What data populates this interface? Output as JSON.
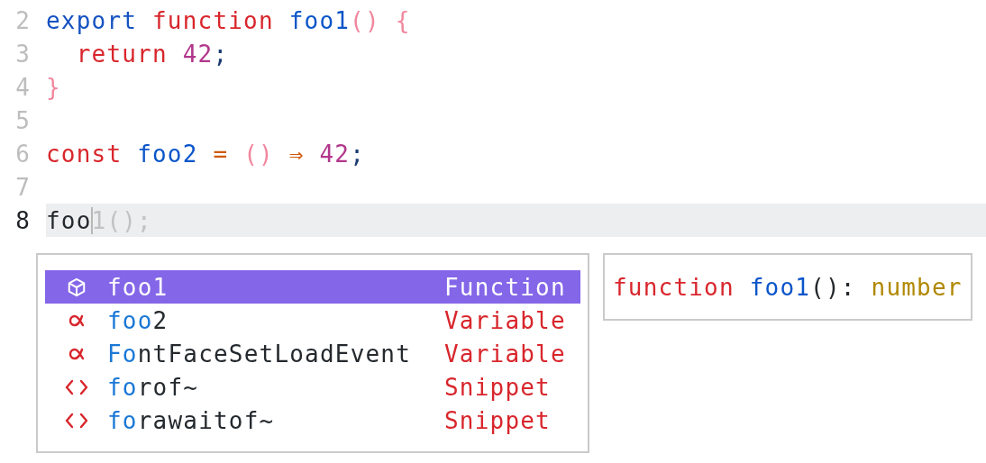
{
  "editor": {
    "lines": [
      {
        "number": "2",
        "active": false,
        "tokens": [
          {
            "text": "export ",
            "kind": "export"
          },
          {
            "text": "function ",
            "kind": "keyword"
          },
          {
            "text": "foo1",
            "kind": "name"
          },
          {
            "text": "() {",
            "kind": "punct"
          }
        ]
      },
      {
        "number": "3",
        "active": false,
        "tokens": [
          {
            "text": "  return ",
            "kind": "keyword"
          },
          {
            "text": "42",
            "kind": "number"
          },
          {
            "text": ";",
            "kind": "semi"
          }
        ]
      },
      {
        "number": "4",
        "active": false,
        "tokens": [
          {
            "text": "}",
            "kind": "punct"
          }
        ]
      },
      {
        "number": "5",
        "active": false
      },
      {
        "number": "6",
        "active": false,
        "tokens": [
          {
            "text": "const ",
            "kind": "keyword"
          },
          {
            "text": "foo2 ",
            "kind": "name"
          },
          {
            "text": "= ",
            "kind": "operator"
          },
          {
            "text": "() ",
            "kind": "punct"
          },
          {
            "text": "⇒ ",
            "kind": "operator"
          },
          {
            "text": "42",
            "kind": "number"
          },
          {
            "text": ";",
            "kind": "semi"
          }
        ]
      },
      {
        "number": "7",
        "active": false
      },
      {
        "number": "8",
        "active": true,
        "tokens": [
          {
            "text": "foo",
            "kind": "plain"
          },
          {
            "kind": "cursor"
          },
          {
            "text": "1();",
            "kind": "ghost"
          }
        ]
      }
    ]
  },
  "completion": {
    "items": [
      {
        "kind": "function",
        "selected": true,
        "label": [
          {
            "text": "foo1"
          }
        ],
        "detail": "Function"
      },
      {
        "kind": "variable",
        "selected": false,
        "label": [
          {
            "text": "foo",
            "match": true
          },
          {
            "text": "2",
            "match": false
          }
        ],
        "detail": "Variable"
      },
      {
        "kind": "variable",
        "selected": false,
        "label": [
          {
            "text": "F",
            "match": true
          },
          {
            "text": "o",
            "match": true
          },
          {
            "text": "ntFaceSetLoadEvent",
            "match": false
          }
        ],
        "detail": "Variable"
      },
      {
        "kind": "snippet",
        "selected": false,
        "label": [
          {
            "text": "fo",
            "match": true
          },
          {
            "text": "rof~",
            "match": false
          }
        ],
        "detail": "Snippet"
      },
      {
        "kind": "snippet",
        "selected": false,
        "label": [
          {
            "text": "fo",
            "match": true
          },
          {
            "text": "rawaitof~",
            "match": false
          }
        ],
        "detail": "Snippet"
      }
    ]
  },
  "signature": {
    "tokens": [
      {
        "text": "function ",
        "kind": "keyword"
      },
      {
        "text": "foo1",
        "kind": "name"
      },
      {
        "text": "(): ",
        "kind": "plain"
      },
      {
        "text": "number",
        "kind": "type"
      }
    ]
  }
}
